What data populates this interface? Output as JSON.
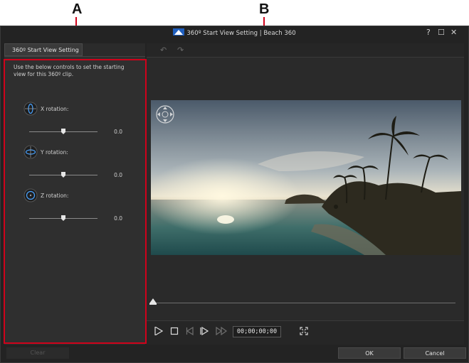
{
  "callouts": {
    "a": "A",
    "b": "B"
  },
  "window": {
    "title": "360º Start View Setting | Beach 360",
    "help": "?",
    "maximize": "☐",
    "close": "✕"
  },
  "left_panel": {
    "tab_label": "360º Start View Setting",
    "instructions": "Use the below controls to set the starting view for this 360º clip.",
    "rotations": [
      {
        "label": "X rotation:",
        "value": "0.0",
        "level": 0.5,
        "icon": "x-rotation-icon"
      },
      {
        "label": "Y rotation:",
        "value": "0.0",
        "level": 0.5,
        "icon": "y-rotation-icon"
      },
      {
        "label": "Z rotation:",
        "value": "0.0",
        "level": 0.5,
        "icon": "z-rotation-icon"
      }
    ]
  },
  "toolbar": {
    "undo_icon": "undo-icon",
    "redo_icon": "redo-icon"
  },
  "player": {
    "timecode": "00;00;00;00",
    "progress": 0.0
  },
  "footer": {
    "clear": "Clear",
    "ok": "OK",
    "cancel": "Cancel"
  },
  "colors": {
    "callout": "#d0021b",
    "background": "#232323"
  }
}
